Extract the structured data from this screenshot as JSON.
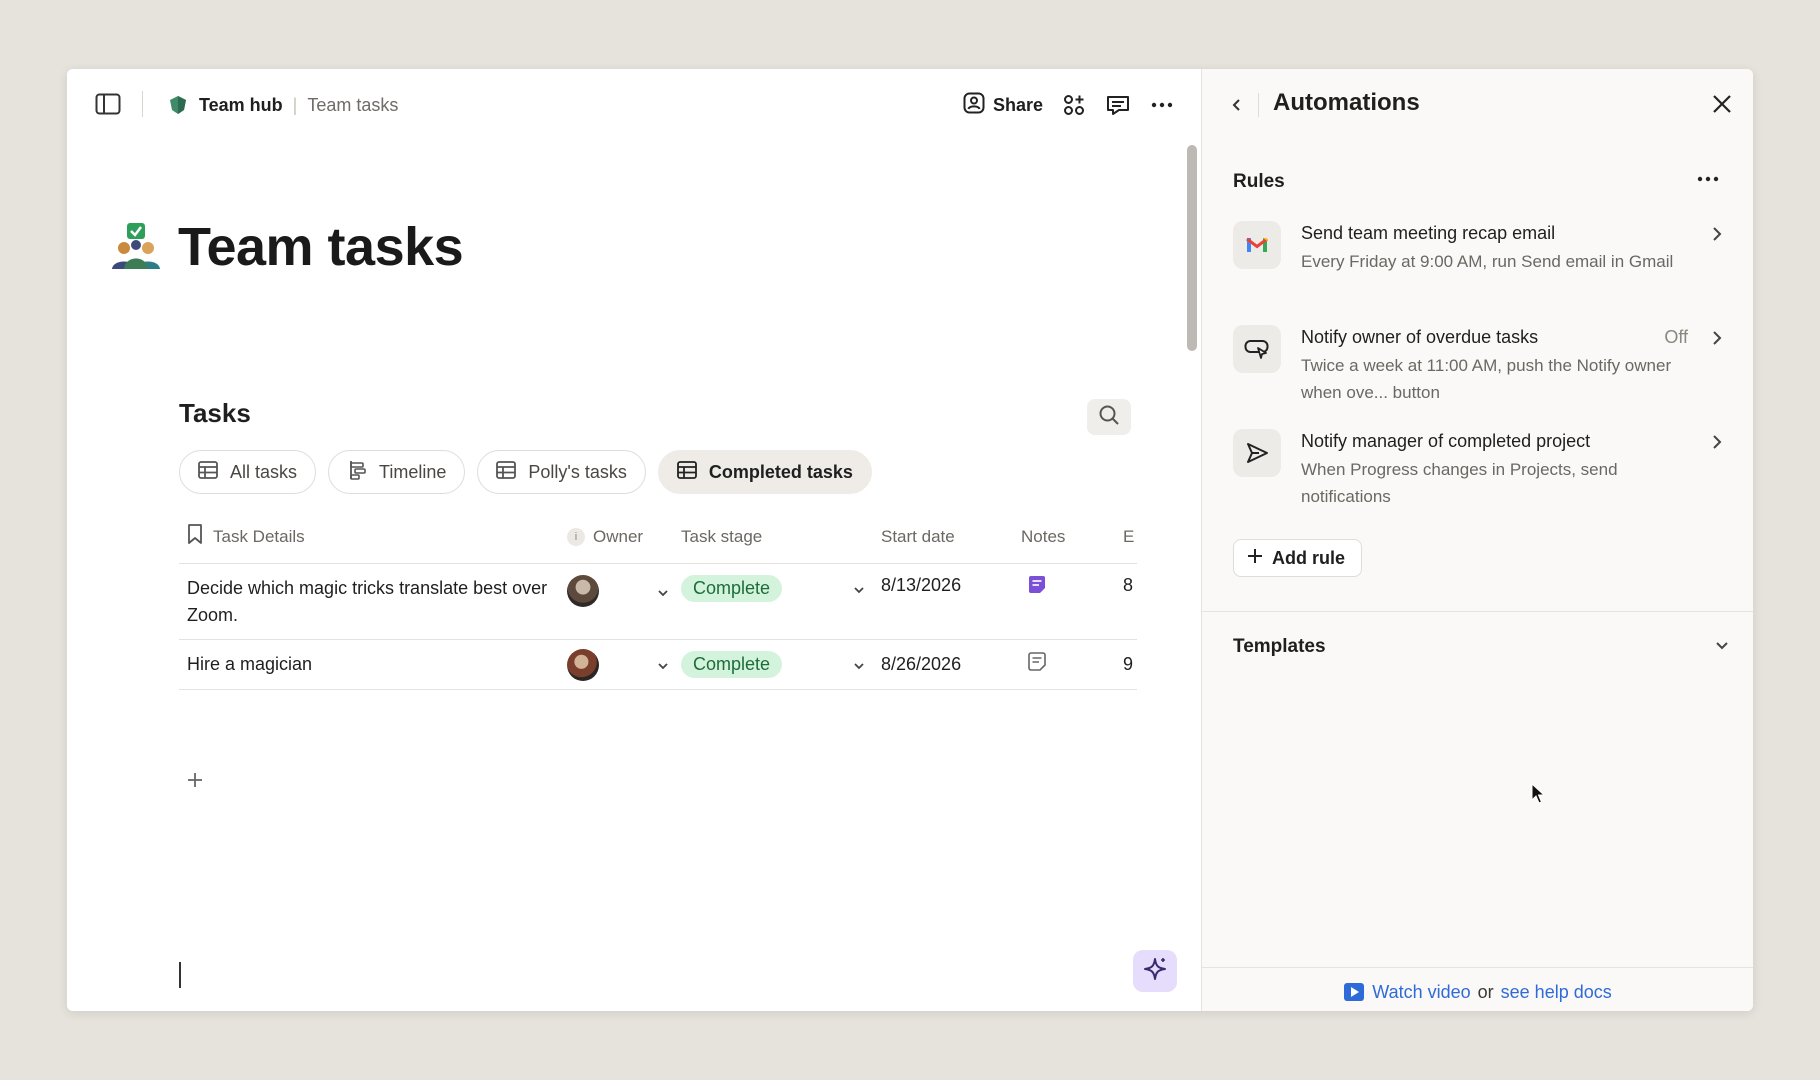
{
  "topbar": {
    "hub_name": "Team hub",
    "page_name": "Team tasks",
    "share_label": "Share"
  },
  "page": {
    "title": "Team tasks"
  },
  "tasks_section": {
    "title": "Tasks",
    "tabs": [
      {
        "label": "All tasks",
        "icon": "table-icon"
      },
      {
        "label": "Timeline",
        "icon": "timeline-icon"
      },
      {
        "label": "Polly's tasks",
        "icon": "table-icon"
      },
      {
        "label": "Completed tasks",
        "icon": "table-icon",
        "active": true
      }
    ],
    "columns": [
      "Task Details",
      "Owner",
      "Task stage",
      "Start date",
      "Notes",
      "E"
    ],
    "rows": [
      {
        "task": "Decide which magic tricks translate best over Zoom.",
        "stage": "Complete",
        "start": "8/13/2026",
        "notes_filled": true,
        "e": "8"
      },
      {
        "task": "Hire a magician",
        "stage": "Complete",
        "start": "8/26/2026",
        "notes_filled": false,
        "e": "9"
      }
    ]
  },
  "panel": {
    "title": "Automations",
    "rules_label": "Rules",
    "rules": [
      {
        "title": "Send team meeting recap email",
        "desc": "Every Friday at 9:00 AM, run Send email in Gmail",
        "status": "",
        "icon": "gmail-icon"
      },
      {
        "title": "Notify owner of overdue tasks",
        "desc": "Twice a week at 11:00 AM, push the Notify owner when ove... button",
        "status": "Off",
        "icon": "push-button-icon"
      },
      {
        "title": "Notify manager of completed project",
        "desc": "When Progress changes in Projects, send notifications",
        "status": "",
        "icon": "send-icon"
      }
    ],
    "add_rule_label": "Add rule",
    "templates_label": "Templates",
    "footer": {
      "watch_video": "Watch video",
      "or": "or",
      "help_docs": "see help docs"
    }
  },
  "colors": {
    "stage_complete_bg": "#d4f3dc",
    "stage_complete_text": "#1d6d3a",
    "link": "#2f6ad9",
    "ai_button_bg": "#e6dcfb",
    "notes_icon": "#7b4fd6"
  }
}
